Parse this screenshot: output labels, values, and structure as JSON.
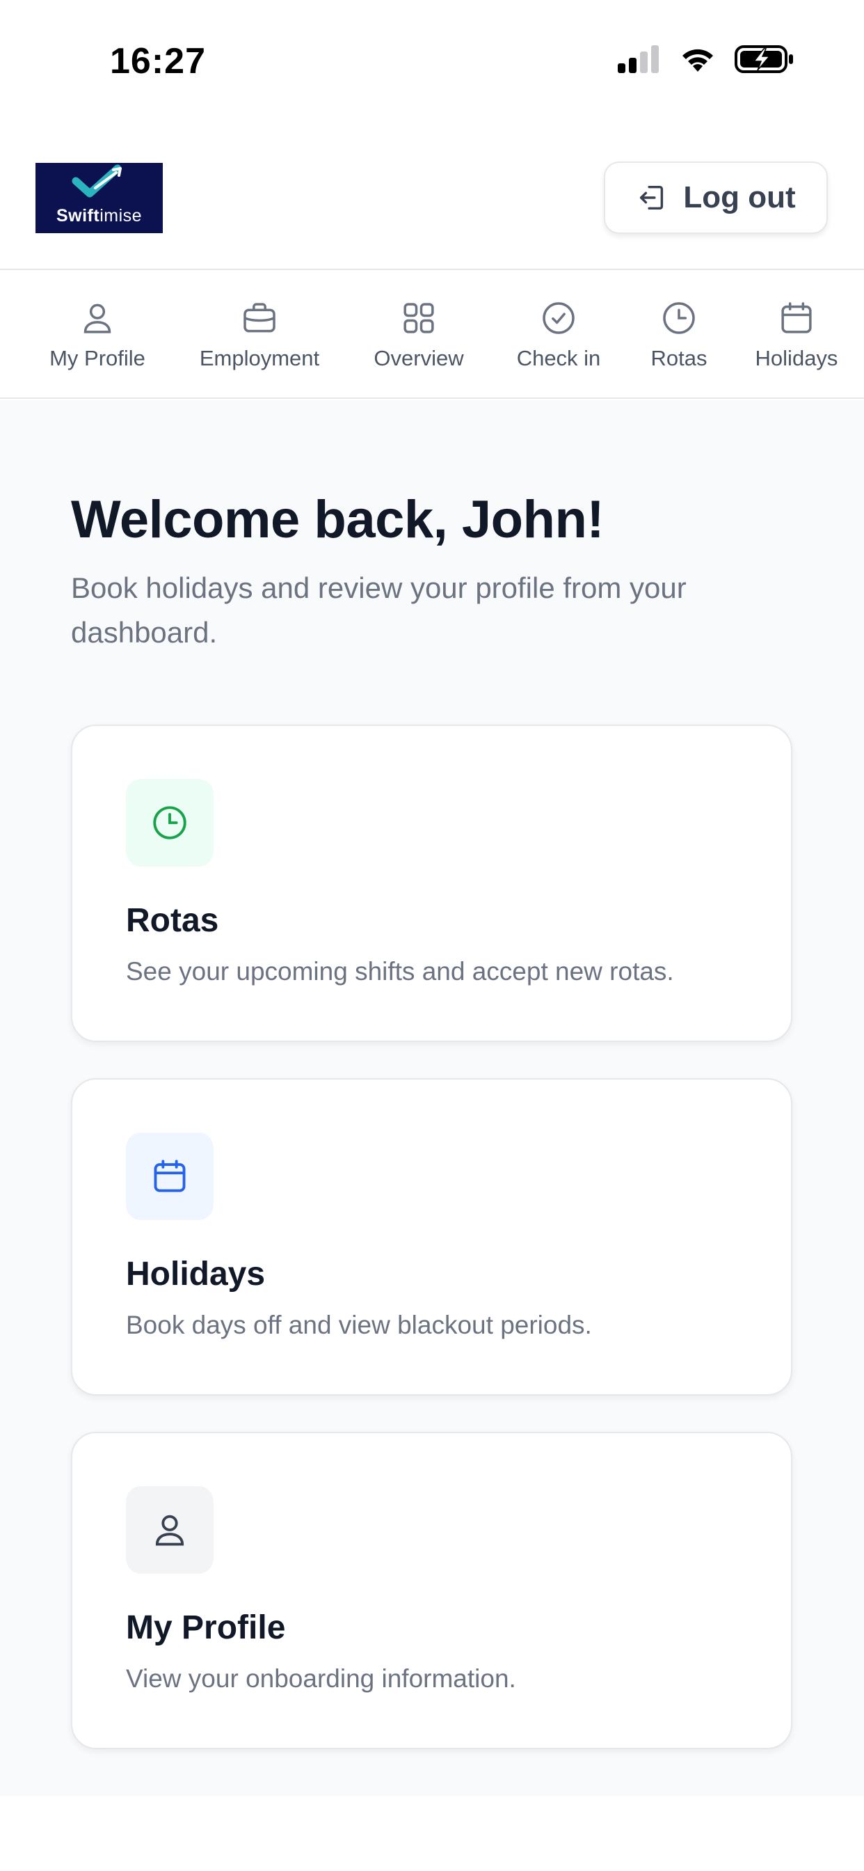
{
  "status_bar": {
    "time": "16:27"
  },
  "header": {
    "logo_text_bold": "Swift",
    "logo_text_light": "imise",
    "logout_label": "Log out"
  },
  "nav": {
    "items": [
      {
        "label": "My Profile",
        "icon": "user-icon"
      },
      {
        "label": "Employment",
        "icon": "briefcase-icon"
      },
      {
        "label": "Overview",
        "icon": "grid-icon"
      },
      {
        "label": "Check in",
        "icon": "check-circle-icon"
      },
      {
        "label": "Rotas",
        "icon": "clock-icon"
      },
      {
        "label": "Holidays",
        "icon": "calendar-icon"
      }
    ]
  },
  "welcome": {
    "title": "Welcome back, John!",
    "subtitle": "Book holidays and review your profile from your dashboard."
  },
  "cards": [
    {
      "title": "Rotas",
      "description": "See your upcoming shifts and accept new rotas.",
      "icon": "clock-icon",
      "icon_color": "#16a34a",
      "icon_bg": "#ecfdf5"
    },
    {
      "title": "Holidays",
      "description": "Book days off and view blackout periods.",
      "icon": "calendar-icon",
      "icon_color": "#2563eb",
      "icon_bg": "#eff6ff"
    },
    {
      "title": "My Profile",
      "description": "View your onboarding information.",
      "icon": "user-icon",
      "icon_color": "#374151",
      "icon_bg": "#f3f4f6"
    }
  ],
  "colors": {
    "logo_bg": "#0c1250",
    "logo_check": "#2bb3c0",
    "text_primary": "#111827",
    "text_secondary": "#6b7280",
    "page_bg": "#f8fafc"
  }
}
